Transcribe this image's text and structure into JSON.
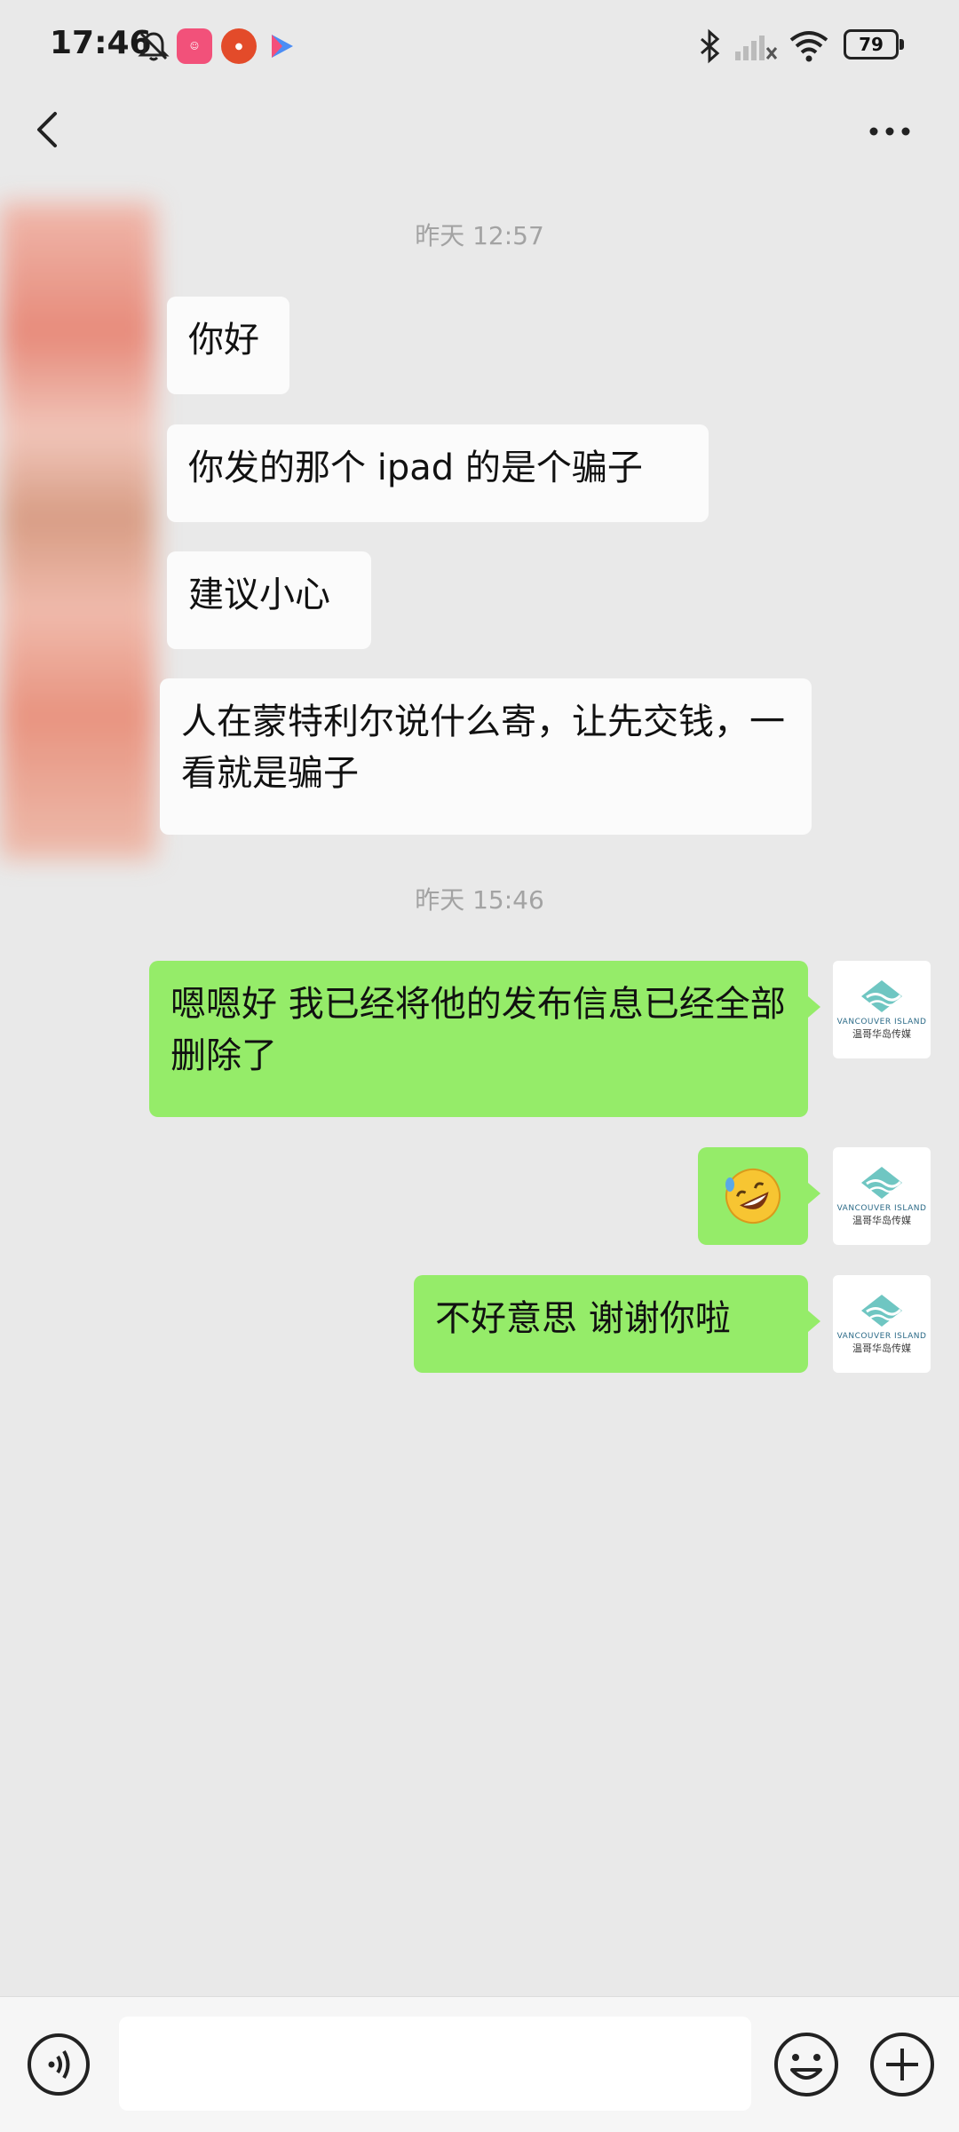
{
  "status_bar": {
    "time": "17:46",
    "battery": "79",
    "icons": [
      "mute-icon",
      "app-icon-1",
      "app-icon-2",
      "app-icon-3",
      "bluetooth-icon",
      "signal-icon",
      "wifi-icon",
      "battery-icon"
    ]
  },
  "top_bar": {
    "back_icon": "chevron-left-icon",
    "more_icon": "ellipsis-icon"
  },
  "messages": [
    {
      "type": "timestamp",
      "text": "昨天 12:57"
    },
    {
      "type": "incoming",
      "text": "你好"
    },
    {
      "type": "incoming",
      "text": "你发的那个 ipad 的是个骗子"
    },
    {
      "type": "incoming",
      "text": "建议小心"
    },
    {
      "type": "incoming",
      "text": "人在蒙特利尔说什么寄，让先交钱，一看就是骗子"
    },
    {
      "type": "timestamp",
      "text": "昨天 15:46"
    },
    {
      "type": "outgoing",
      "text": "嗯嗯好 我已经将他的发布信息已经全部删除了"
    },
    {
      "type": "outgoing",
      "text": "",
      "emoji": "rolling-laughing-emoji"
    },
    {
      "type": "outgoing",
      "text": "不好意思 谢谢你啦"
    }
  ],
  "avatar": {
    "label_en": "VANCOUVER ISLAND",
    "label_cn": "温哥华岛传媒"
  },
  "input_bar": {
    "voice_icon": "voice-icon",
    "emoji_icon": "smiley-icon",
    "plus_icon": "plus-icon",
    "input_value": ""
  },
  "colors": {
    "background": "#e9e9e9",
    "outgoing_bubble": "#95ec69",
    "incoming_bubble": "#fbfbfb"
  }
}
